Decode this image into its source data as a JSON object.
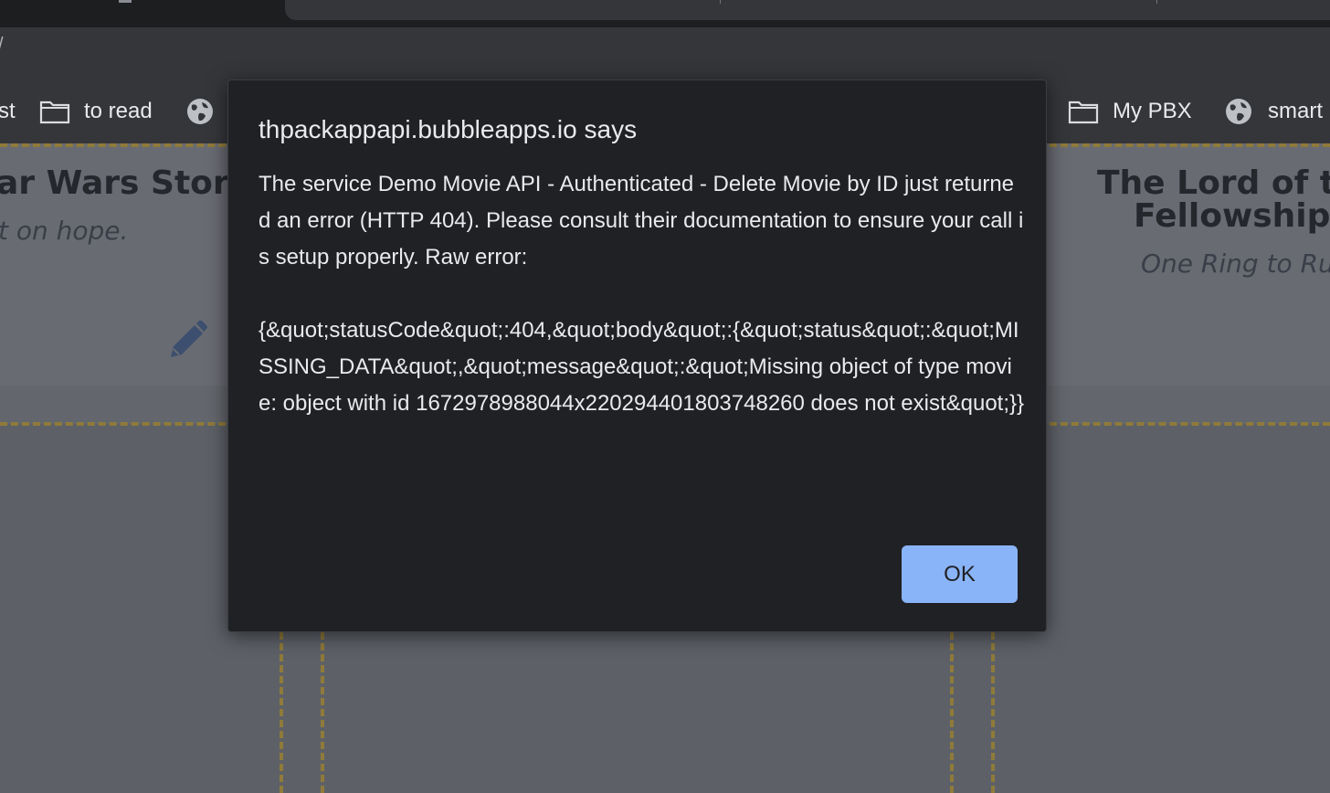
{
  "browser": {
    "bookmarks": [
      {
        "label": "st",
        "icon": "none"
      },
      {
        "label": "to read",
        "icon": "folder-icon"
      },
      {
        "label": "",
        "icon": "globe-icon"
      },
      {
        "label": "My PBX",
        "icon": "folder-icon"
      },
      {
        "label": "smart",
        "icon": "globe-icon"
      }
    ]
  },
  "page": {
    "cards": [
      {
        "title": "ar Wars Story",
        "tagline": "t on hope."
      },
      {
        "title_line1": "The Lord of the",
        "title_line2": "Fellowship o",
        "tagline": "One Ring to Rul"
      }
    ]
  },
  "dialog": {
    "title": "thpackappapi.bubbleapps.io says",
    "message": "The service Demo Movie API - Authenticated - Delete Movie by ID just returned an error (HTTP 404). Please consult their documentation to ensure your call is setup properly. Raw error:\n\n{&quot;statusCode&quot;:404,&quot;body&quot;:{&quot;status&quot;:&quot;MISSING_DATA&quot;,&quot;message&quot;:&quot;Missing object of type movie: object with id 1672978988044x220294401803748260 does not exist&quot;}}",
    "ok_label": "OK"
  },
  "colors": {
    "dialog_bg": "#202124",
    "button_bg": "#8ab4f8",
    "text": "#e8eaed"
  }
}
